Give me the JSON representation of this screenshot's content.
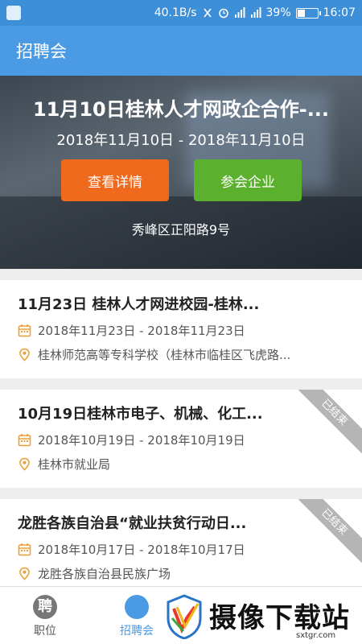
{
  "status_bar": {
    "speed": "40.1B/s",
    "battery_percent": "39%",
    "battery_level": 0.39,
    "time": "16:07"
  },
  "app_bar": {
    "title": "招聘会"
  },
  "banner": {
    "title": "11月10日桂林人才网政企合作-...",
    "dates": "2018年11月10日 - 2018年11月10日",
    "details_button": "查看详情",
    "companies_button": "参会企业",
    "address": "秀峰区正阳路9号"
  },
  "cards": [
    {
      "title": "11月23日 桂林人才网进校园-桂林...",
      "dates": "2018年11月23日 - 2018年11月23日",
      "location": "桂林师范高等专科学校（桂林市临桂区飞虎路...",
      "ended": false
    },
    {
      "title": "10月19日桂林市电子、机械、化工...",
      "dates": "2018年10月19日 - 2018年10月19日",
      "location": "桂林市就业局",
      "ended": true,
      "ended_label": "已结束"
    },
    {
      "title": "龙胜各族自治县“就业扶贫行动日...",
      "dates": "2018年10月17日 - 2018年10月17日",
      "location": "龙胜各族自治县民族广场",
      "ended": true,
      "ended_label": "已结束"
    }
  ],
  "tab_bar": {
    "jobs_label": "职位",
    "jobs_glyph": "聘",
    "fair_label": "招聘会"
  },
  "watermark": {
    "text": "摄像下载站",
    "url": "sxtgr.com"
  },
  "colors": {
    "primary": "#4a9be3",
    "details_button": "#f06a1d",
    "companies_button": "#5bb02e",
    "icon_orange": "#f0a030"
  }
}
